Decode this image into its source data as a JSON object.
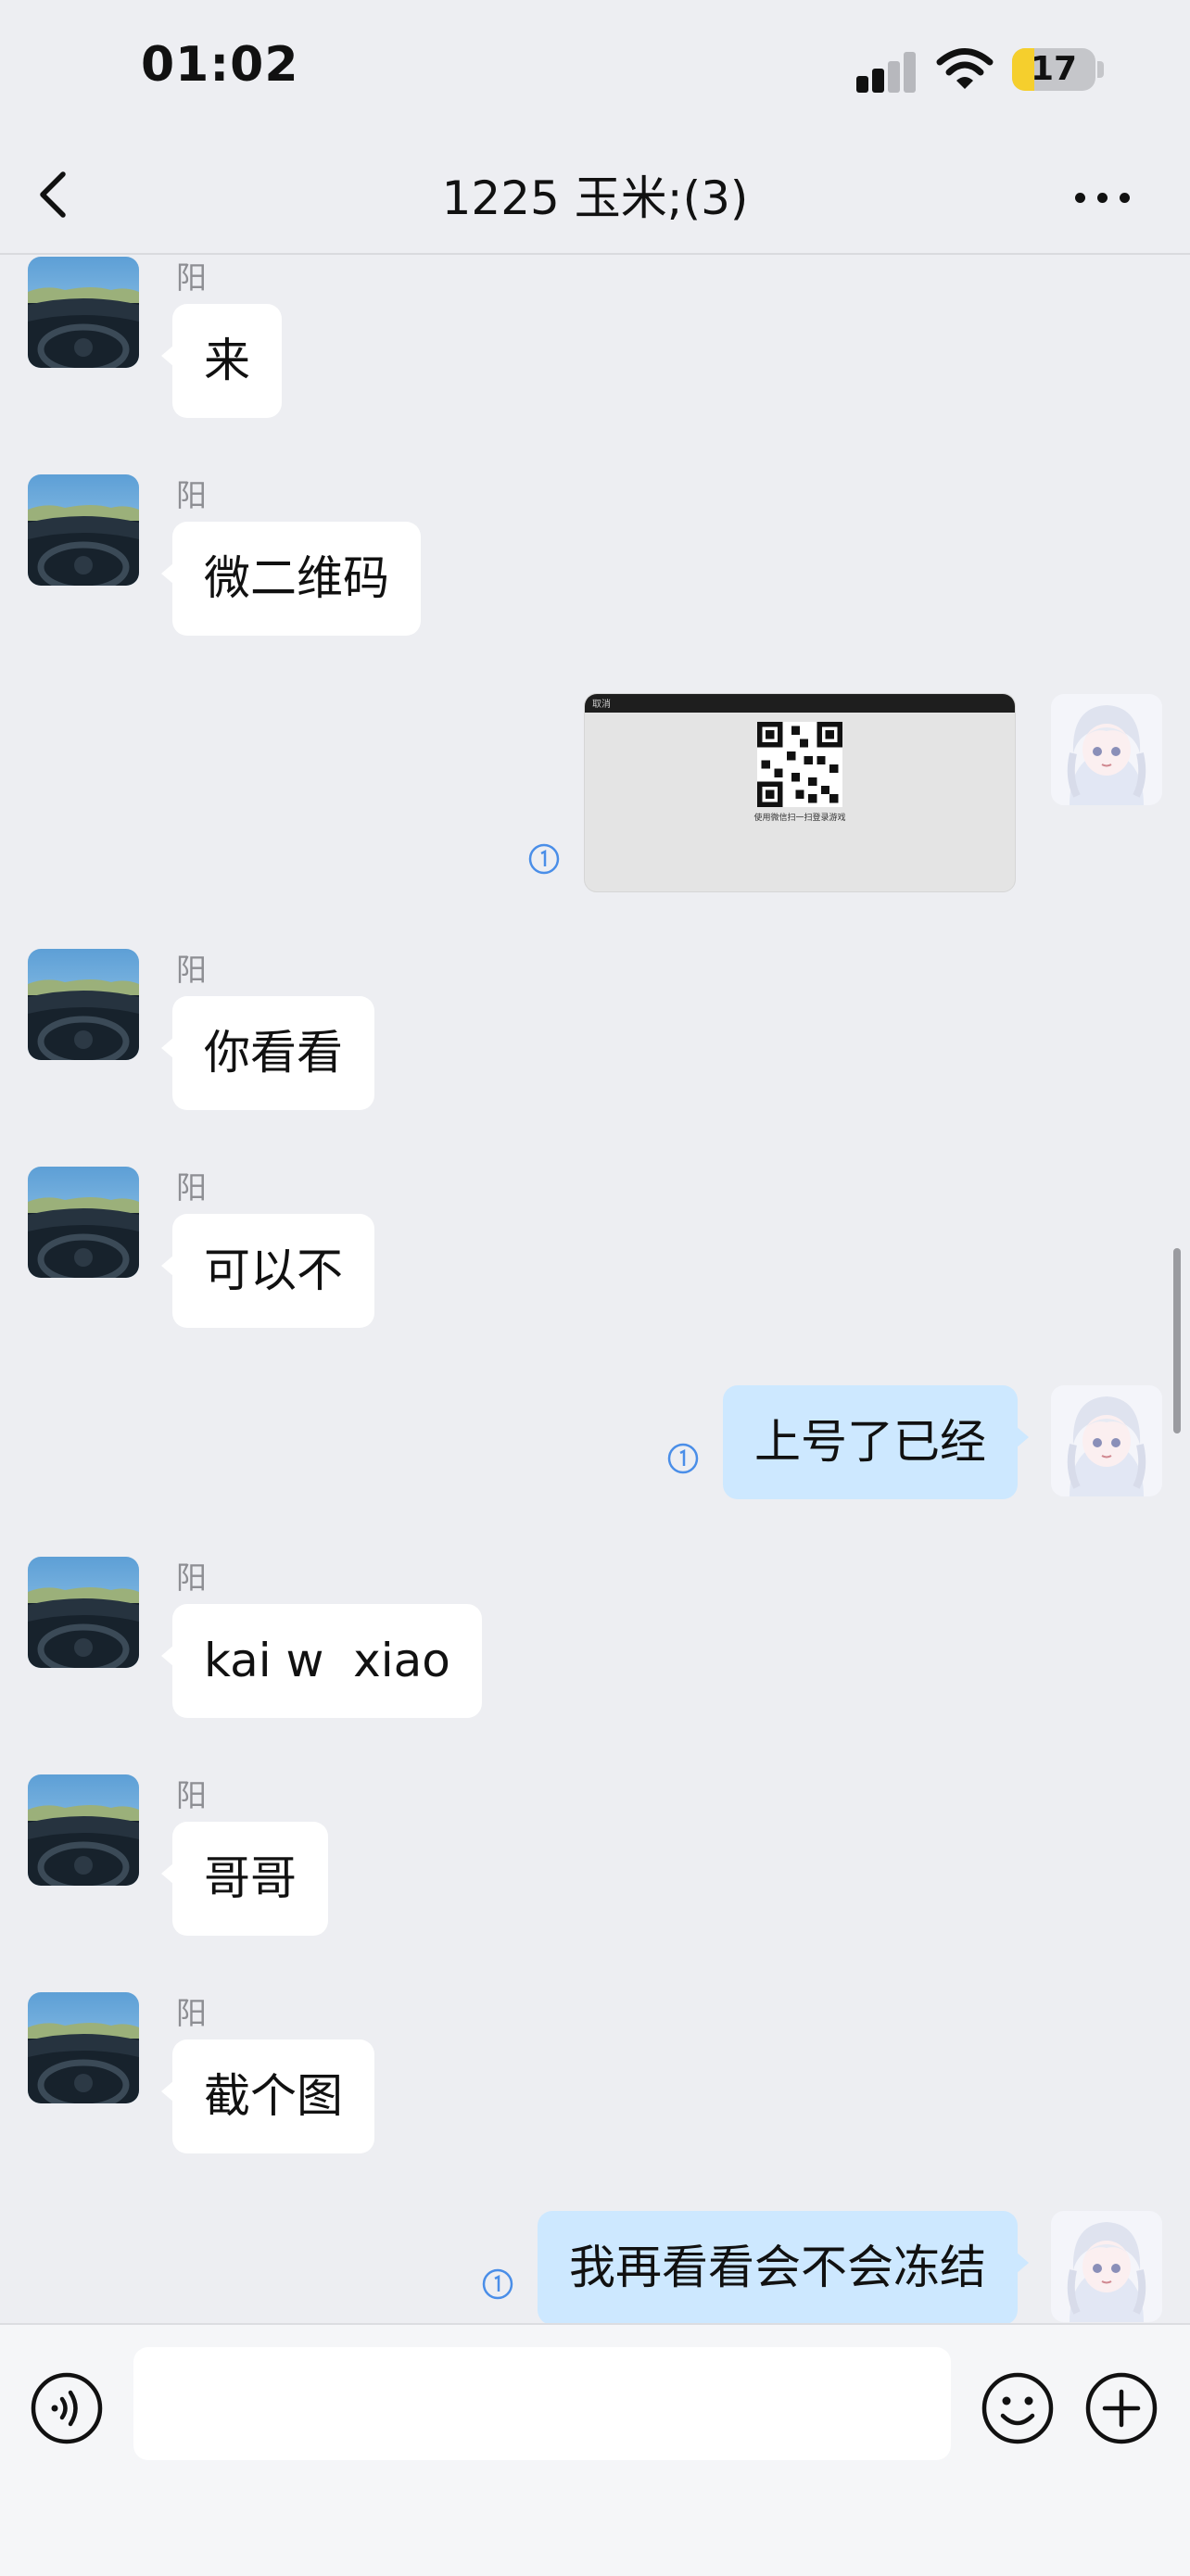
{
  "status": {
    "time": "01:02",
    "battery": "17",
    "battery_level": 0.17
  },
  "header": {
    "title": "1225 玉米;(3)"
  },
  "messages": [
    {
      "sender": "阳",
      "text": "来"
    },
    {
      "sender": "阳",
      "text": "微二维码"
    },
    {
      "image_caption": "使用微信扫一扫登录游戏",
      "image_toolbar_text": "取消",
      "read_count": "1"
    },
    {
      "sender": "阳",
      "text": "你看看"
    },
    {
      "sender": "阳",
      "text": "可以不"
    },
    {
      "text": "上号了已经",
      "read_count": "1"
    },
    {
      "sender": "阳",
      "text": "kai w  xiao"
    },
    {
      "sender": "阳",
      "text": "哥哥"
    },
    {
      "sender": "阳",
      "text": "截个图"
    },
    {
      "text": "我再看看会不会冻结",
      "read_count": "1"
    }
  ],
  "input": {
    "placeholder": ""
  },
  "colors": {
    "my_bubble": "#cde8ff",
    "their_bubble": "#ffffff",
    "background": "#edeef2",
    "read_indicator": "#4a8ee8"
  },
  "icons": [
    "back-arrow-icon",
    "more-icon",
    "voice-icon",
    "emoji-icon",
    "plus-icon",
    "signal-icon",
    "wifi-icon",
    "battery-icon"
  ]
}
